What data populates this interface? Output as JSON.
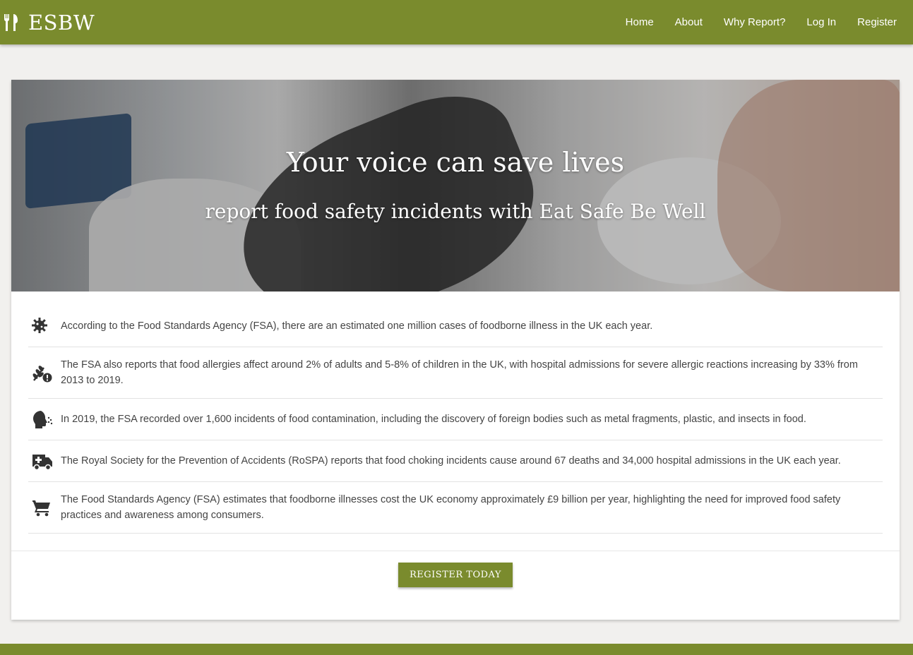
{
  "brand": {
    "name": "ESBW",
    "icon": "utensils-icon"
  },
  "nav": {
    "home": "Home",
    "about": "About",
    "why": "Why Report?",
    "login": "Log In",
    "register": "Register"
  },
  "hero": {
    "title": "Your voice can save lives",
    "subtitle": "report food safety incidents with Eat Safe Be Well"
  },
  "stats": [
    {
      "icon": "virus-icon",
      "text": "According to the Food Standards Agency (FSA), there are an estimated one million cases of foodborne illness in the UK each year."
    },
    {
      "icon": "allergy-wheat-icon",
      "text": "The FSA also reports that food allergies affect around 2% of adults and 5-8% of children in the UK, with hospital admissions for severe allergic reactions increasing by 33% from 2013 to 2019."
    },
    {
      "icon": "head-sneeze-icon",
      "text": "In 2019, the FSA recorded over 1,600 incidents of food contamination, including the discovery of foreign bodies such as metal fragments, plastic, and insects in food."
    },
    {
      "icon": "ambulance-icon",
      "text": "The Royal Society for the Prevention of Accidents (RoSPA) reports that food choking incidents cause around 67 deaths and 34,000 hospital admissions in the UK each year."
    },
    {
      "icon": "shopping-cart-icon",
      "text": "The Food Standards Agency (FSA) estimates that foodborne illnesses cost the UK economy approximately £9 billion per year, highlighting the need for improved food safety practices and awareness among consumers."
    }
  ],
  "cta": {
    "label": "REGISTER TODAY"
  },
  "colors": {
    "primary": "#7a8b2d",
    "background": "#f1f0ee",
    "icon": "#333333"
  }
}
